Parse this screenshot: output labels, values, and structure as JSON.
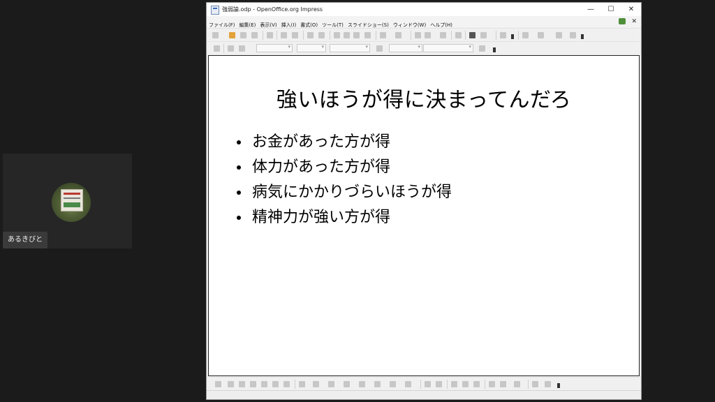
{
  "participant": {
    "name": "あるきびと",
    "avatar_icon": "avatar-photo"
  },
  "window": {
    "title": "強弱論.odp - OpenOffice.org Impress",
    "controls": {
      "minimize": "—",
      "maximize": "☐",
      "close": "✕"
    }
  },
  "menubar": {
    "items": [
      "ファイル(F)",
      "編集(E)",
      "表示(V)",
      "挿入(I)",
      "書式(O)",
      "ツール(T)",
      "スライドショー(S)",
      "ウィンドウ(W)",
      "ヘルプ(H)"
    ],
    "close_document": "✕"
  },
  "slide": {
    "title": "強いほうが得に決まってんだろ",
    "bullets": [
      "お金があった方が得",
      "体力があった方が得",
      "病気にかかりづらいほうが得",
      "精神力が強い方が得"
    ]
  },
  "colors": {
    "page_background": "#1b1b1b",
    "slide_background": "#ffffff",
    "text": "#000000"
  }
}
